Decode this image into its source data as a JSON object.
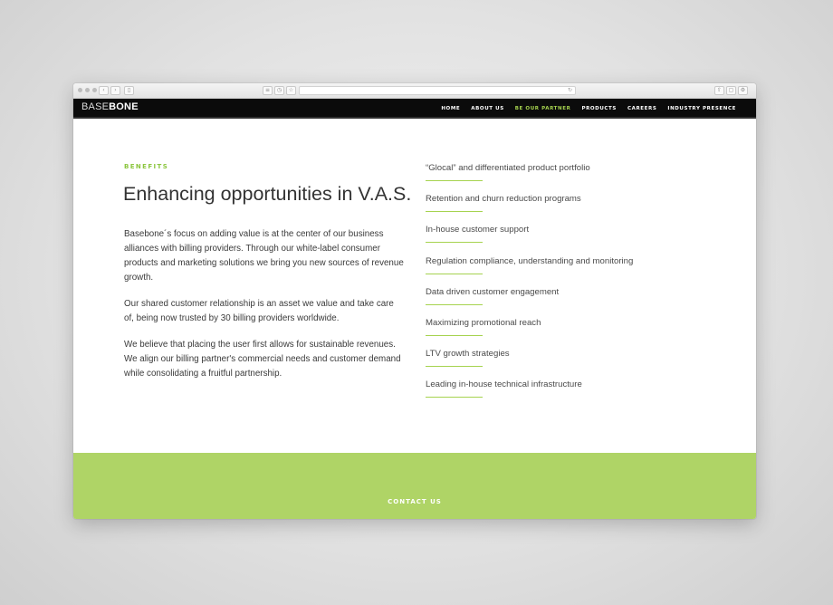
{
  "browser": {
    "buttons": {
      "back": "‹",
      "forward": "›",
      "sidebar": "▯",
      "reader": "≡",
      "history": "◷",
      "bookmarks": "☆",
      "reload": "↻",
      "share": "⇧",
      "tabs": "▢",
      "settings": "⚙"
    }
  },
  "site": {
    "logo_part1": "BASE",
    "logo_part2": "BONE",
    "nav": [
      {
        "label": "HOME",
        "active": false
      },
      {
        "label": "ABOUT US",
        "active": false
      },
      {
        "label": "BE OUR PARTNER",
        "active": true
      },
      {
        "label": "PRODUCTS",
        "active": false
      },
      {
        "label": "CAREERS",
        "active": false
      },
      {
        "label": "INDUSTRY PRESENCE",
        "active": false
      }
    ]
  },
  "main": {
    "eyebrow": "BENEFITS",
    "title": "Enhancing opportunities in V.A.S.",
    "paragraphs": [
      "Basebone´s focus on adding value is at the center of our business alliances with billing providers. Through our white-label consumer products and marketing solutions we bring you new sources of revenue growth.",
      "Our shared customer relationship is an asset we value and take care of, being now trusted by 30 billing providers worldwide.",
      "We believe that placing the user first allows for sustainable revenues. We align our billing partner's commercial needs and customer demand while consolidating a fruitful partnership."
    ],
    "benefits": [
      "“Glocal” and differentiated product portfolio",
      "Retention and churn reduction programs",
      "In-house customer support",
      "Regulation compliance, understanding and monitoring",
      "Data driven customer engagement",
      "Maximizing promotional reach",
      "LTV growth strategies",
      "Leading in-house technical infrastructure"
    ]
  },
  "footer": {
    "contact_label": "CONTACT US"
  },
  "colors": {
    "accent_green": "#8cc63f",
    "footer_green": "#afd466",
    "header_black": "#0b0b0b"
  }
}
